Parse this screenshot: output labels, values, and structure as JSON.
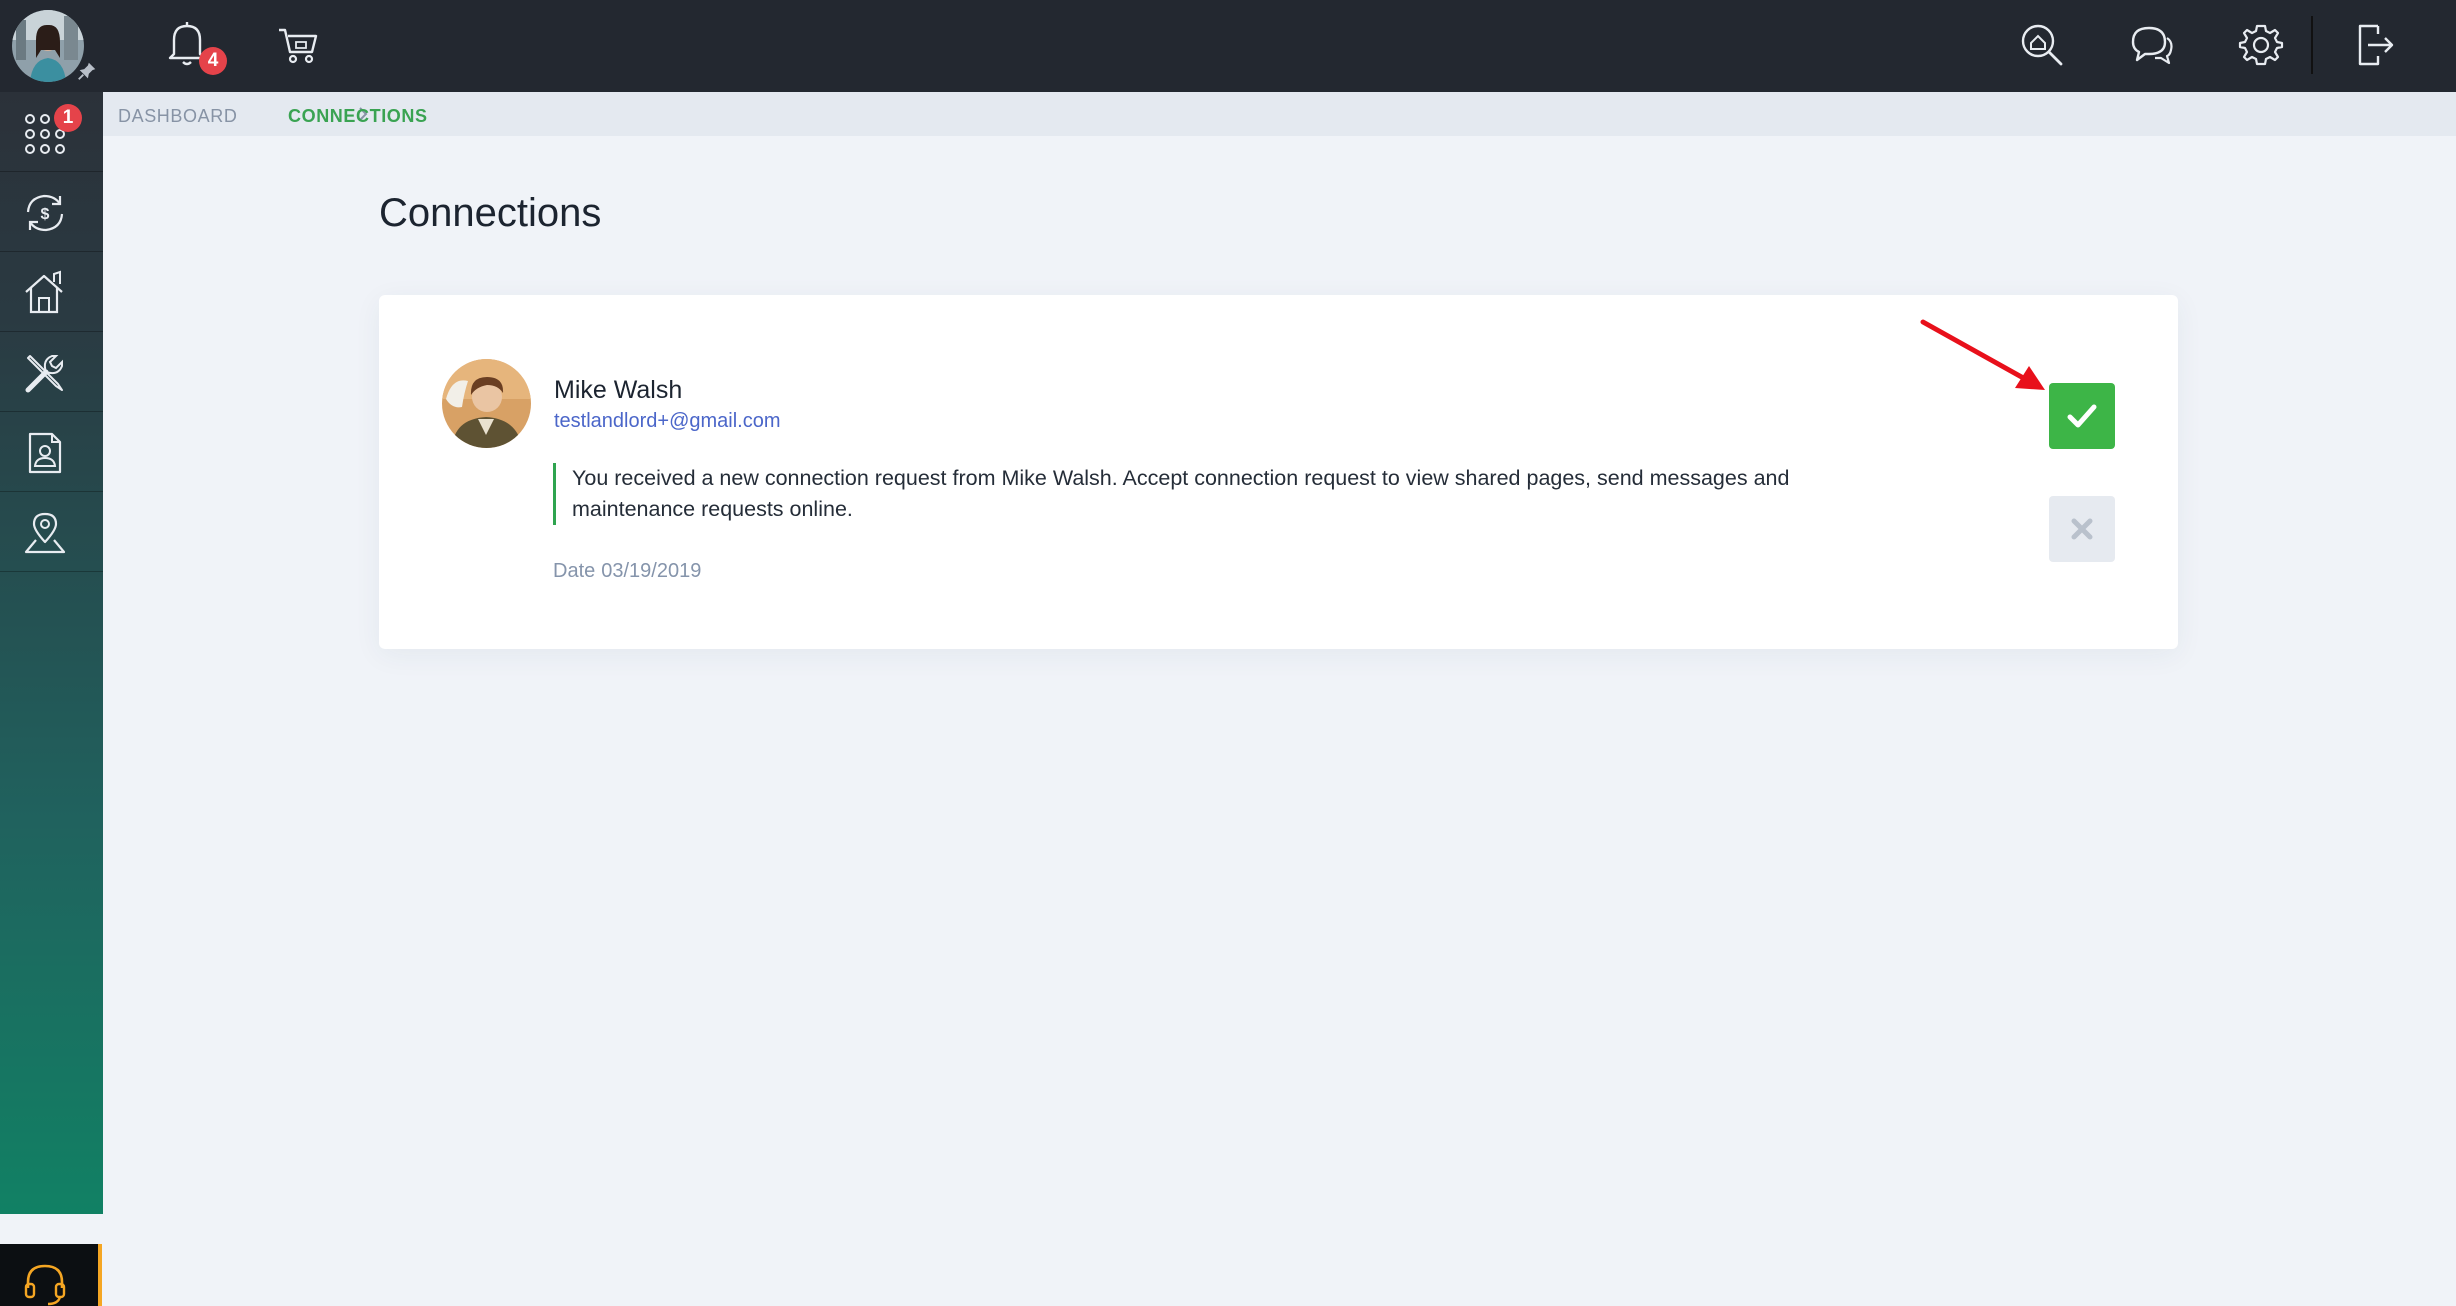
{
  "topbar": {
    "notifications_count": "4",
    "icons": [
      "bell-icon",
      "cart-icon",
      "search-home-icon",
      "chat-icon",
      "gear-icon",
      "logout-icon"
    ]
  },
  "sidebar": {
    "apps_badge": "1",
    "items": [
      {
        "name": "apps-grid-icon"
      },
      {
        "name": "money-cycle-icon"
      },
      {
        "name": "property-house-icon"
      },
      {
        "name": "tools-icon"
      },
      {
        "name": "contact-document-icon"
      },
      {
        "name": "map-pin-icon"
      }
    ],
    "support_icon": "headset-icon"
  },
  "breadcrumb": {
    "items": [
      "DASHBOARD",
      "CONNECTIONS"
    ]
  },
  "page": {
    "title": "Connections"
  },
  "request": {
    "name": "Mike Walsh",
    "email": "testlandlord+@gmail.com",
    "message": "You received a new connection request from Mike Walsh. Accept connection request to view shared pages, send messages and maintenance requests online.",
    "date_label": "Date",
    "date": "03/19/2019"
  },
  "colors": {
    "accent_green": "#3db547",
    "breadcrumb_active": "#3aa352",
    "badge_red": "#e5434a",
    "annotation_red": "#e8101b",
    "link_blue": "#4b66c9"
  }
}
